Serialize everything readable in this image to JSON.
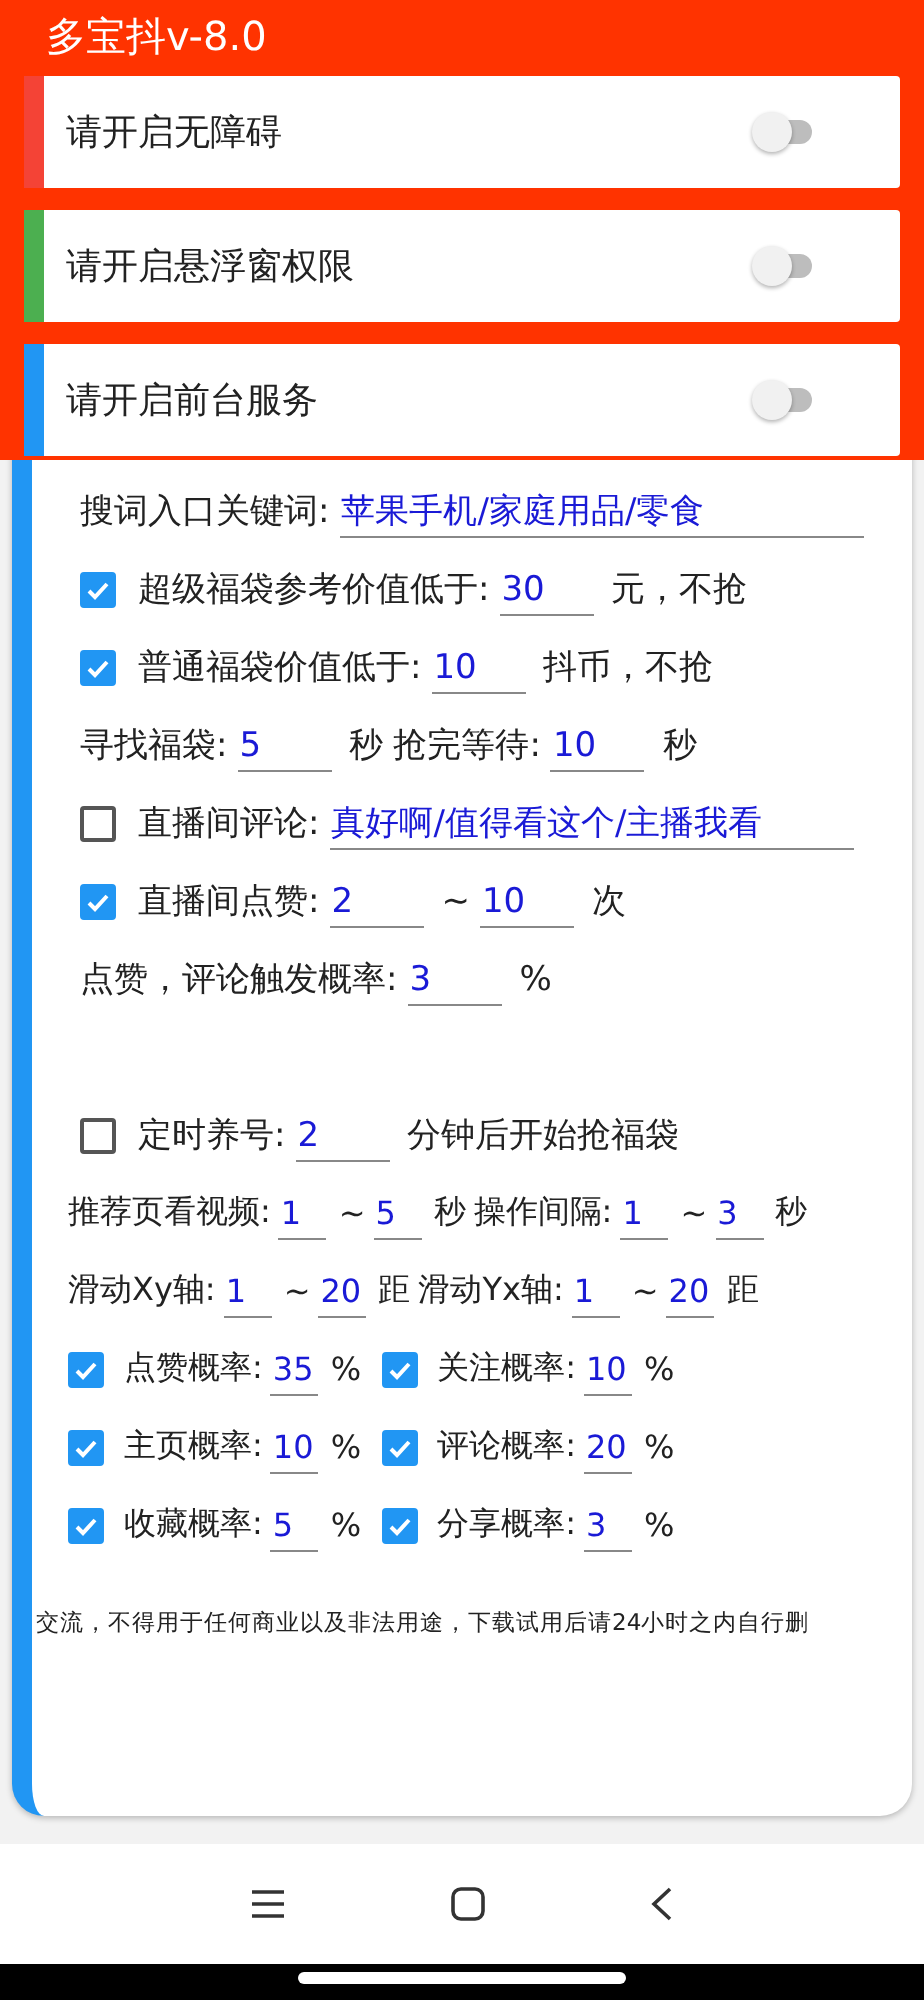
{
  "app_title": "多宝抖v-8.0",
  "permissions": [
    {
      "label": "请开启无障碍",
      "color": "#f44336",
      "on": false
    },
    {
      "label": "请开启悬浮窗权限",
      "color": "#4caf50",
      "on": false
    },
    {
      "label": "请开启前台服务",
      "color": "#2196f3",
      "on": false
    }
  ],
  "settings_rows": [
    {
      "parts": [
        {
          "kind": "text",
          "text": "搜词入口关键词:"
        },
        {
          "kind": "long_field",
          "value": "苹果手机/家庭用品/零食"
        }
      ]
    },
    {
      "parts": [
        {
          "kind": "checkbox",
          "checked": true
        },
        {
          "kind": "text",
          "text": "超级福袋参考价值低于:"
        },
        {
          "kind": "field",
          "value": "30"
        },
        {
          "kind": "text",
          "text": "元，不抢"
        }
      ]
    },
    {
      "parts": [
        {
          "kind": "checkbox",
          "checked": true
        },
        {
          "kind": "text",
          "text": "普通福袋价值低于:"
        },
        {
          "kind": "field",
          "value": "10"
        },
        {
          "kind": "text",
          "text": "抖币，不抢"
        }
      ]
    },
    {
      "parts": [
        {
          "kind": "text",
          "text": "寻找福袋:"
        },
        {
          "kind": "field",
          "value": "5"
        },
        {
          "kind": "text",
          "text": "秒"
        },
        {
          "kind": "text",
          "text": "抢完等待:"
        },
        {
          "kind": "field",
          "value": "10"
        },
        {
          "kind": "text",
          "text": "秒"
        }
      ]
    },
    {
      "parts": [
        {
          "kind": "checkbox",
          "checked": false
        },
        {
          "kind": "text",
          "text": "直播间评论:"
        },
        {
          "kind": "long_field",
          "value": "真好啊/值得看这个/主播我看"
        }
      ]
    },
    {
      "parts": [
        {
          "kind": "checkbox",
          "checked": true
        },
        {
          "kind": "text",
          "text": "直播间点赞:"
        },
        {
          "kind": "field",
          "value": "2"
        },
        {
          "kind": "text",
          "text": "~"
        },
        {
          "kind": "field",
          "value": "10"
        },
        {
          "kind": "text",
          "text": "次"
        }
      ]
    },
    {
      "parts": [
        {
          "kind": "text",
          "text": "点赞，评论触发概率:"
        },
        {
          "kind": "field",
          "value": "3"
        },
        {
          "kind": "text",
          "text": "%"
        }
      ]
    },
    {
      "parts": [
        {
          "kind": "gap"
        }
      ]
    },
    {
      "parts": [
        {
          "kind": "checkbox",
          "checked": false
        },
        {
          "kind": "text",
          "text": "定时养号:"
        },
        {
          "kind": "field",
          "value": "2"
        },
        {
          "kind": "text",
          "text": "分钟后开始抢福袋"
        }
      ]
    },
    {
      "parts": [
        {
          "kind": "small_text",
          "text": "推荐页看视频:"
        },
        {
          "kind": "small_field",
          "value": "1"
        },
        {
          "kind": "small_text",
          "text": "~"
        },
        {
          "kind": "small_field",
          "value": "5"
        },
        {
          "kind": "small_text",
          "text": "秒"
        },
        {
          "kind": "small_text",
          "text": "操作间隔:"
        },
        {
          "kind": "small_field",
          "value": "1"
        },
        {
          "kind": "small_text",
          "text": "~"
        },
        {
          "kind": "small_field",
          "value": "3"
        },
        {
          "kind": "small_text",
          "text": "秒"
        }
      ]
    },
    {
      "parts": [
        {
          "kind": "small_text",
          "text": "滑动Xy轴:"
        },
        {
          "kind": "small_field",
          "value": "1"
        },
        {
          "kind": "small_text",
          "text": "~"
        },
        {
          "kind": "small_field",
          "value": "20"
        },
        {
          "kind": "small_text",
          "text": "距"
        },
        {
          "kind": "small_text",
          "text": "滑动Yx轴:"
        },
        {
          "kind": "small_field",
          "value": "1"
        },
        {
          "kind": "small_text",
          "text": "~"
        },
        {
          "kind": "small_field",
          "value": "20"
        },
        {
          "kind": "small_text",
          "text": "距"
        }
      ]
    },
    {
      "parts": [
        {
          "kind": "checkbox",
          "checked": true
        },
        {
          "kind": "small_text",
          "text": "点赞概率:"
        },
        {
          "kind": "small_field",
          "value": "35"
        },
        {
          "kind": "small_text",
          "text": "%"
        },
        {
          "kind": "checkbox",
          "checked": true
        },
        {
          "kind": "small_text",
          "text": "关注概率:"
        },
        {
          "kind": "small_field",
          "value": "10"
        },
        {
          "kind": "small_text",
          "text": "%"
        }
      ]
    },
    {
      "parts": [
        {
          "kind": "checkbox",
          "checked": true
        },
        {
          "kind": "small_text",
          "text": "主页概率:"
        },
        {
          "kind": "small_field",
          "value": "10"
        },
        {
          "kind": "small_text",
          "text": "%"
        },
        {
          "kind": "checkbox",
          "checked": true
        },
        {
          "kind": "small_text",
          "text": "评论概率:"
        },
        {
          "kind": "small_field",
          "value": "20"
        },
        {
          "kind": "small_text",
          "text": "%"
        }
      ]
    },
    {
      "parts": [
        {
          "kind": "checkbox",
          "checked": true
        },
        {
          "kind": "small_text",
          "text": "收藏概率:"
        },
        {
          "kind": "small_field",
          "value": "5"
        },
        {
          "kind": "small_text",
          "text": "%"
        },
        {
          "kind": "checkbox",
          "checked": true
        },
        {
          "kind": "small_text",
          "text": "分享概率:"
        },
        {
          "kind": "small_field",
          "value": "3"
        },
        {
          "kind": "small_text",
          "text": "%"
        }
      ]
    }
  ],
  "disclaimer": "交流，不得用于任何商业以及非法用途，下载试用后请24小时之内自行删"
}
